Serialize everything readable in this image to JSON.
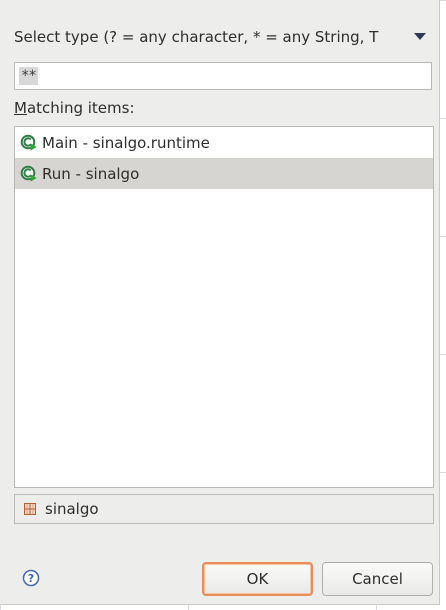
{
  "dialog": {
    "header": {
      "text": "Select type (? = any character, * = any String, T",
      "dropdown_icon": "triangle-down-icon"
    },
    "search": {
      "value": "**"
    },
    "matching": {
      "label_prefix": "",
      "label_accesskey": "M",
      "label_rest": "atching items:"
    },
    "items": [
      {
        "label": "Main - sinalgo.runtime",
        "icon": "class-runnable-icon",
        "selected": false
      },
      {
        "label": "Run - sinalgo",
        "icon": "class-runnable-icon",
        "selected": true
      }
    ],
    "package": {
      "label": "sinalgo",
      "icon": "package-icon"
    },
    "help_icon": "help-icon",
    "buttons": {
      "ok": "OK",
      "cancel": "Cancel"
    },
    "colors": {
      "dialog_bg": "#ededeb",
      "selected_row": "#d6d5d2",
      "default_button_border": "#e98d5b",
      "class_icon": "#2f7d45",
      "help_icon": "#3f68b6"
    }
  }
}
